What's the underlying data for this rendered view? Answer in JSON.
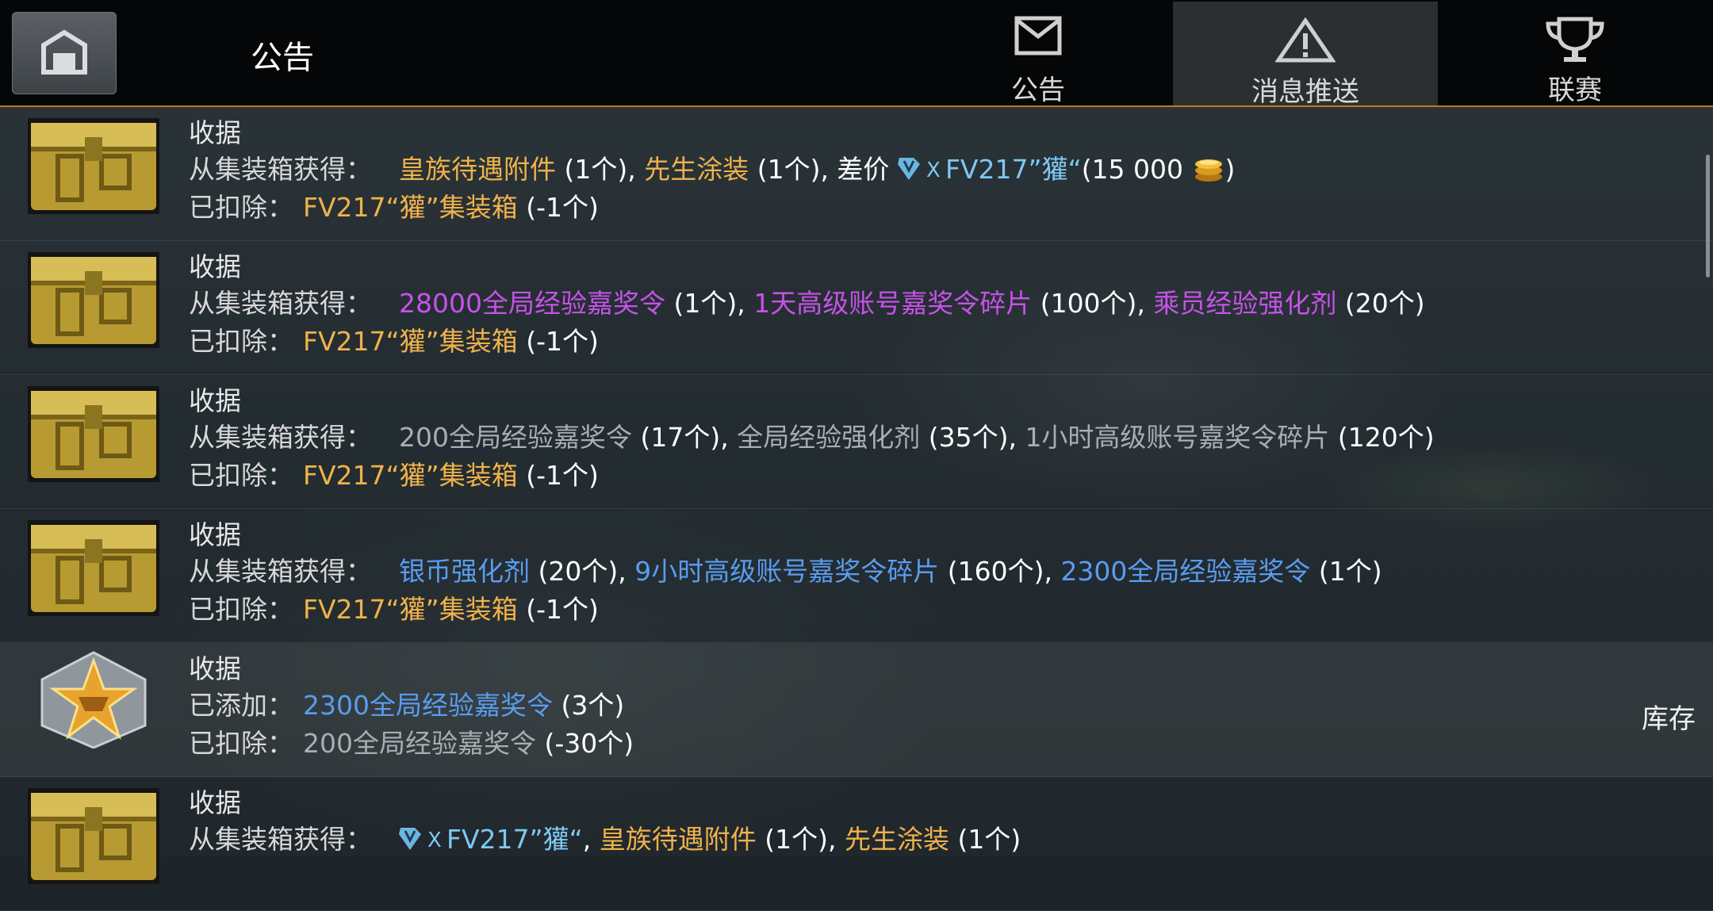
{
  "header": {
    "title": "公告",
    "tabs": [
      {
        "label": "公告",
        "icon": "envelope-icon"
      },
      {
        "label": "消息推送",
        "icon": "warning-icon",
        "active": true
      },
      {
        "label": "联赛",
        "icon": "trophy-icon"
      }
    ]
  },
  "rows": [
    {
      "icon": "gold-crate-icon",
      "title": "收据",
      "line2_label": "从集装箱获得：",
      "line2_items": [
        {
          "text": "皇族待遇附件",
          "color": "gold"
        },
        {
          "text": " (1个)",
          "color": "white"
        },
        {
          "text": ", ",
          "color": "white"
        },
        {
          "text": "先生涂装",
          "color": "gold"
        },
        {
          "text": " (1个)",
          "color": "white"
        },
        {
          "text": ", 差价 ",
          "color": "white"
        },
        {
          "text": "FV217”獾“",
          "color": "cyan"
        },
        {
          "text": "(15 000 ",
          "color": "white"
        },
        {
          "text": ")",
          "color": "white"
        }
      ],
      "line3_label": "已扣除：",
      "line3_item": "FV217“獾”集装箱",
      "line3_count": " (-1个)"
    },
    {
      "icon": "gold-crate-icon",
      "title": "收据",
      "line2_label": "从集装箱获得：",
      "line2_items": [
        {
          "text": "28000全局经验嘉奖令",
          "color": "purple"
        },
        {
          "text": " (1个)",
          "color": "white"
        },
        {
          "text": ", ",
          "color": "white"
        },
        {
          "text": "1天高级账号嘉奖令碎片",
          "color": "purple"
        },
        {
          "text": " (100个)",
          "color": "white"
        },
        {
          "text": ", ",
          "color": "white"
        },
        {
          "text": "乘员经验强化剂",
          "color": "purple"
        },
        {
          "text": " (20个)",
          "color": "white"
        }
      ],
      "line3_label": "已扣除：",
      "line3_item": "FV217“獾”集装箱",
      "line3_count": " (-1个)"
    },
    {
      "icon": "gold-crate-icon",
      "title": "收据",
      "line2_label": "从集装箱获得：",
      "line2_items": [
        {
          "text": "200全局经验嘉奖令",
          "color": "gray"
        },
        {
          "text": " (17个)",
          "color": "white"
        },
        {
          "text": ", ",
          "color": "white"
        },
        {
          "text": "全局经验强化剂",
          "color": "gray"
        },
        {
          "text": " (35个)",
          "color": "white"
        },
        {
          "text": ", ",
          "color": "white"
        },
        {
          "text": "1小时高级账号嘉奖令碎片",
          "color": "gray"
        },
        {
          "text": " (120个)",
          "color": "white"
        }
      ],
      "line3_label": "已扣除：",
      "line3_item": "FV217“獾”集装箱",
      "line3_count": " (-1个)"
    },
    {
      "icon": "gold-crate-icon",
      "title": "收据",
      "line2_label": "从集装箱获得：",
      "line2_items": [
        {
          "text": "银币强化剂",
          "color": "blue"
        },
        {
          "text": " (20个)",
          "color": "white"
        },
        {
          "text": ", ",
          "color": "white"
        },
        {
          "text": "9小时高级账号嘉奖令碎片",
          "color": "blue"
        },
        {
          "text": " (160个)",
          "color": "white"
        },
        {
          "text": ", ",
          "color": "white"
        },
        {
          "text": "2300全局经验嘉奖令",
          "color": "blue"
        },
        {
          "text": " (1个)",
          "color": "white"
        }
      ],
      "line3_label": "已扣除：",
      "line3_item": "FV217“獾”集装箱",
      "line3_count": " (-1个)"
    },
    {
      "icon": "star-medal-icon",
      "title": "收据",
      "line2_label": "已添加：",
      "line2_items": [
        {
          "text": "2300全局经验嘉奖令",
          "color": "blue"
        },
        {
          "text": " (3个)",
          "color": "white"
        }
      ],
      "line3_label": "已扣除：",
      "line3_item": "200全局经验嘉奖令",
      "line3_count": " (-30个)",
      "stock_label": "库存"
    },
    {
      "icon": "gold-crate-icon",
      "title": "收据",
      "line2_label": "从集装箱获得：",
      "line2_items": [
        {
          "text": "FV217”獾“",
          "color": "cyan"
        },
        {
          "text": ", ",
          "color": "white"
        },
        {
          "text": "皇族待遇附件",
          "color": "gold"
        },
        {
          "text": " (1个)",
          "color": "white"
        },
        {
          "text": ", ",
          "color": "white"
        },
        {
          "text": "先生涂装",
          "color": "gold"
        },
        {
          "text": " (1个)",
          "color": "white"
        }
      ]
    }
  ],
  "colors": {
    "accent": "#c07a1a",
    "gold": "#f0b24a",
    "purple": "#c553e8",
    "blue": "#5a9cf0",
    "gray": "#a8aeb2"
  }
}
